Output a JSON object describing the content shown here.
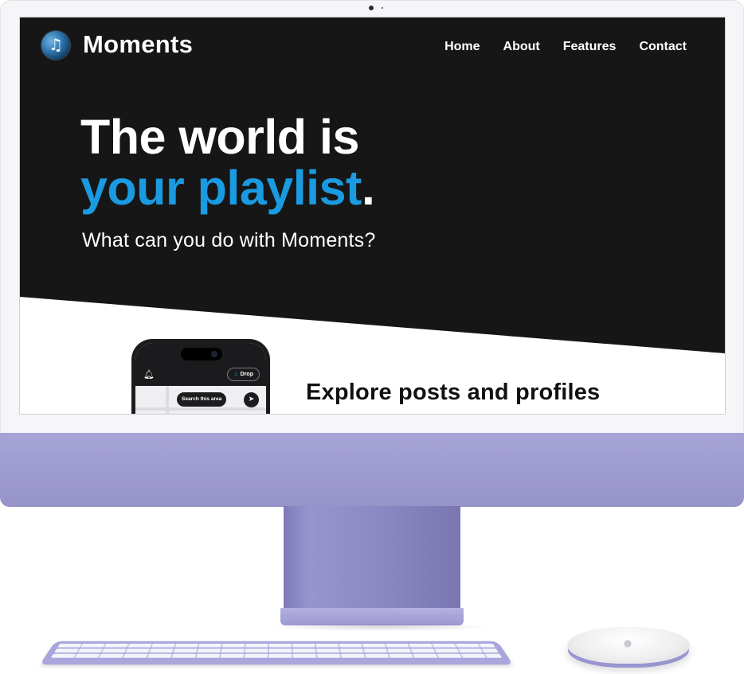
{
  "site": {
    "brand": "Moments",
    "nav": [
      "Home",
      "About",
      "Features",
      "Contact"
    ],
    "headline_line1": "The world is",
    "headline_accent": "your playlist",
    "headline_period": ".",
    "subheadline": "What can you do with Moments?",
    "section_title": "Explore posts and profiles"
  },
  "phone": {
    "drop_label": "Drop",
    "search_label": "Search this area"
  },
  "icons": {
    "logo": "music-globe-icon",
    "bell": "bell-icon",
    "drop": "music-note-icon",
    "locate": "navigation-arrow-icon",
    "mouse_logo": "apple-logo-icon"
  },
  "colors": {
    "hero_bg": "#161616",
    "accent": "#1a9ae0",
    "device": "#a6a3d6"
  }
}
